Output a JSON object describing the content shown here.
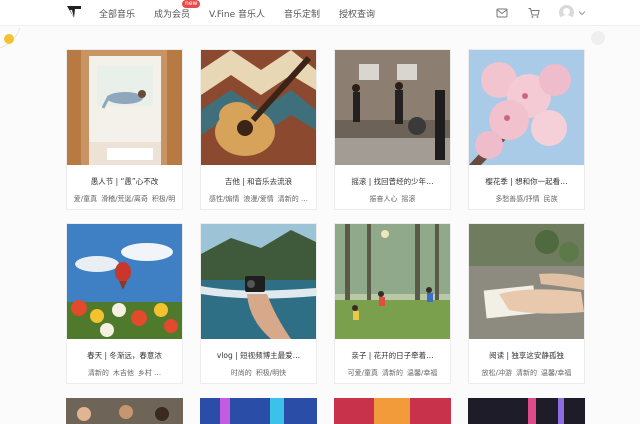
{
  "nav": {
    "items": [
      {
        "label": "全部音乐"
      },
      {
        "label": "成为会员",
        "badge": "new"
      },
      {
        "label": "V.Fine 音乐人"
      },
      {
        "label": "音乐定制"
      },
      {
        "label": "授权查询"
      }
    ]
  },
  "cards": [
    {
      "title": "愚人节 | “愚”心不改",
      "tags": [
        "爱/童真",
        "滑稽/荒诞/离奇",
        "积极/明"
      ]
    },
    {
      "title": "吉他 | 和音乐去流浪",
      "tags": [
        "感性/煽情",
        "浪漫/爱情",
        "清新的 …"
      ]
    },
    {
      "title": "摇滚 | 找回曾经的少年…",
      "tags": [
        "振奋人心",
        "摇滚"
      ]
    },
    {
      "title": "樱花季 | 想和你一起看…",
      "tags": [
        "多愁善感/抒情",
        "民族"
      ]
    },
    {
      "title": "春天 | 冬渐远，春意浓",
      "tags": [
        "清新的",
        "木吉他",
        "乡村 …"
      ]
    },
    {
      "title": "vlog | 短视频博主最爱…",
      "tags": [
        "时尚的",
        "积极/明快"
      ]
    },
    {
      "title": "亲子 | 花开的日子牵着…",
      "tags": [
        "可爱/童真",
        "清新的",
        "温馨/幸福"
      ]
    },
    {
      "title": "阅读 | 独享这安静孤独",
      "tags": [
        "放松/冲游",
        "清新的",
        "温馨/幸福"
      ]
    }
  ]
}
